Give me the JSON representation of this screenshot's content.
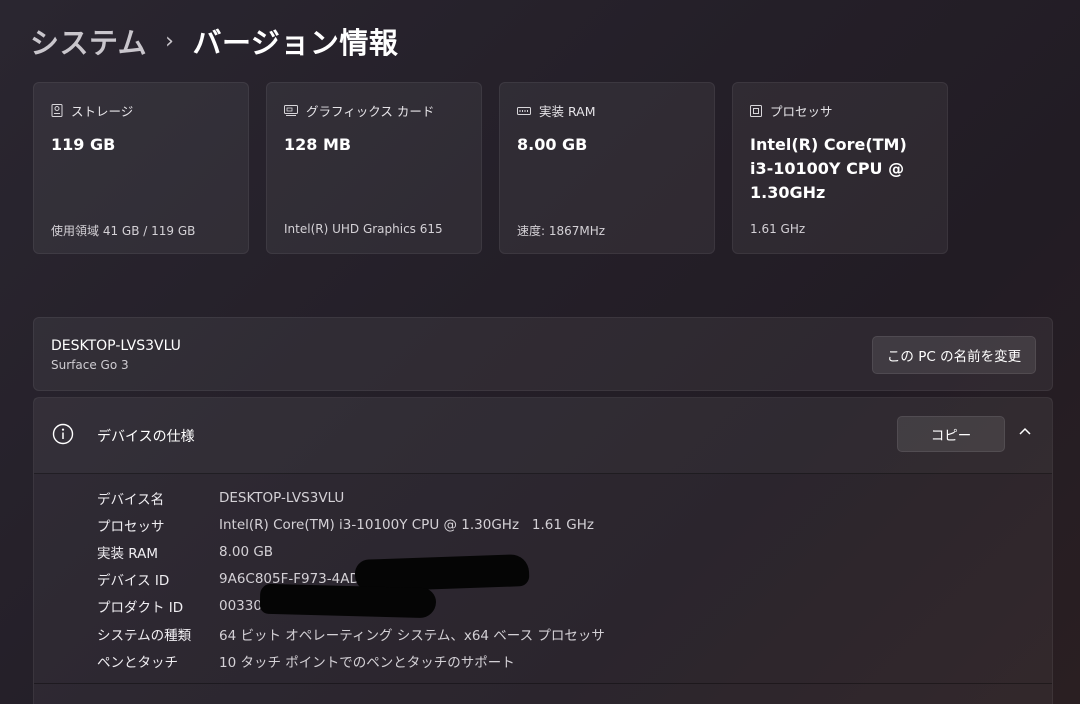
{
  "breadcrumb": {
    "parent": "システム",
    "separator": "›",
    "current": "バージョン情報"
  },
  "cards": {
    "storage": {
      "icon": "storage-icon",
      "label": "ストレージ",
      "value": "119 GB",
      "sub": "使用領域 41 GB / 119 GB"
    },
    "graphics": {
      "icon": "graphics-card-icon",
      "label": "グラフィックス カード",
      "value": "128 MB",
      "sub": "Intel(R) UHD Graphics 615"
    },
    "ram": {
      "icon": "memory-icon",
      "label": "実装 RAM",
      "value": "8.00 GB",
      "sub": "速度: 1867MHz"
    },
    "processor": {
      "icon": "processor-icon",
      "label": "プロセッサ",
      "value": "Intel(R) Core(TM) i3-10100Y CPU @ 1.30GHz",
      "sub": "1.61 GHz"
    }
  },
  "device": {
    "name": "DESKTOP-LVS3VLU",
    "model": "Surface Go 3",
    "rename_button": "この PC の名前を変更"
  },
  "specs": {
    "icon": "info-icon",
    "title": "デバイスの仕様",
    "copy_button": "コピー",
    "rows": [
      {
        "label": "デバイス名",
        "value": "DESKTOP-LVS3VLU"
      },
      {
        "label": "プロセッサ",
        "value": "Intel(R) Core(TM) i3-10100Y CPU @ 1.30GHz   1.61 GHz"
      },
      {
        "label": "実装 RAM",
        "value": "8.00 GB"
      },
      {
        "label": "デバイス ID",
        "value": "9A6C805F-F973-4AD"
      },
      {
        "label": "プロダクト ID",
        "value": "00330"
      },
      {
        "label": "システムの種類",
        "value": "64 ビット オペレーティング システム、x64 ベース プロセッサ"
      },
      {
        "label": "ペンとタッチ",
        "value": "10 タッチ ポイントでのペンとタッチのサポート"
      }
    ]
  },
  "colors": {
    "background": "#241f28",
    "card": "#35303a",
    "text_primary": "#ffffff",
    "text_secondary": "#d4d1d6"
  }
}
